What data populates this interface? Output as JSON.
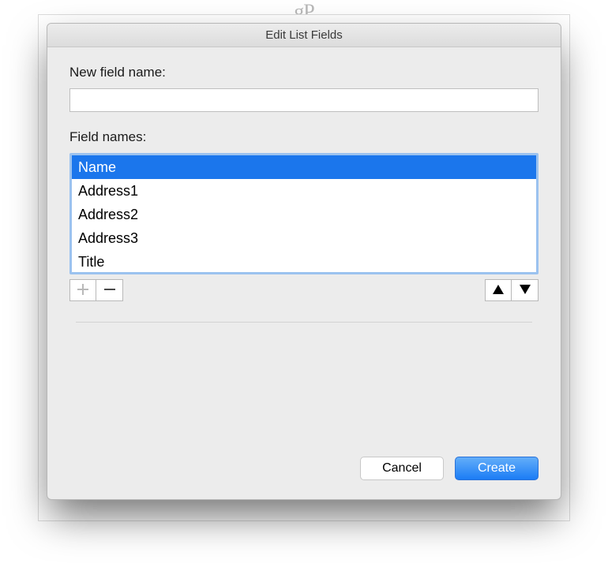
{
  "watermark": "gP",
  "dialog": {
    "title": "Edit List Fields",
    "newFieldLabel": "New field name:",
    "newFieldValue": "",
    "fieldNamesLabel": "Field names:",
    "items": [
      {
        "label": "Name",
        "selected": true
      },
      {
        "label": "Address1",
        "selected": false
      },
      {
        "label": "Address2",
        "selected": false
      },
      {
        "label": "Address3",
        "selected": false
      },
      {
        "label": "Title",
        "selected": false
      }
    ],
    "addDisabled": true,
    "buttons": {
      "cancel": "Cancel",
      "create": "Create"
    }
  }
}
